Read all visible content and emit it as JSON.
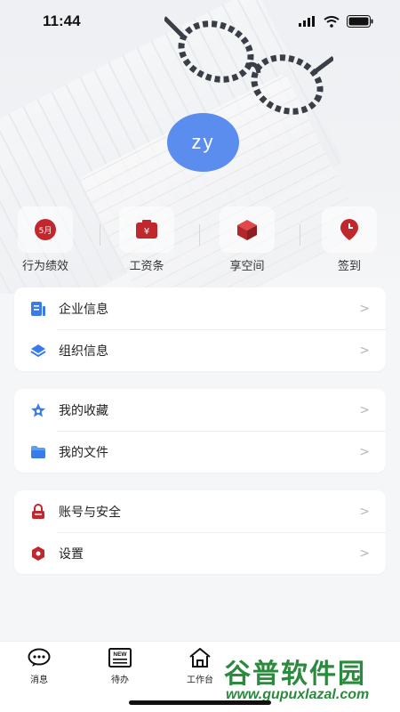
{
  "status_bar": {
    "time": "11:44"
  },
  "profile": {
    "avatar_text": "zy"
  },
  "quick_actions": [
    {
      "label": "行为绩效",
      "icon": "calendar-month-icon",
      "badge": "5月"
    },
    {
      "label": "工资条",
      "icon": "salary-box-icon",
      "badge": "¥"
    },
    {
      "label": "享空间",
      "icon": "cube-icon"
    },
    {
      "label": "签到",
      "icon": "location-clock-icon"
    }
  ],
  "card1": [
    {
      "label": "企业信息",
      "icon": "enterprise-doc-icon"
    },
    {
      "label": "组织信息",
      "icon": "layers-icon"
    }
  ],
  "card2": [
    {
      "label": "我的收藏",
      "icon": "star-icon"
    },
    {
      "label": "我的文件",
      "icon": "folder-icon"
    }
  ],
  "card3": [
    {
      "label": "账号与安全",
      "icon": "lock-icon"
    },
    {
      "label": "设置",
      "icon": "gear-icon"
    }
  ],
  "chevron": ">",
  "tabs": [
    {
      "label": "消息",
      "icon": "chat-bubble-icon"
    },
    {
      "label": "待办",
      "icon": "news-icon",
      "icon_text": "NEW"
    },
    {
      "label": "工作台",
      "icon": "home-icon"
    }
  ],
  "watermark": {
    "title": "谷普软件园",
    "url": "www.gupuxlazal.com"
  },
  "colors": {
    "accent_blue": "#3b7be8",
    "red": "#c0282d",
    "avatar": "#5b8def"
  }
}
